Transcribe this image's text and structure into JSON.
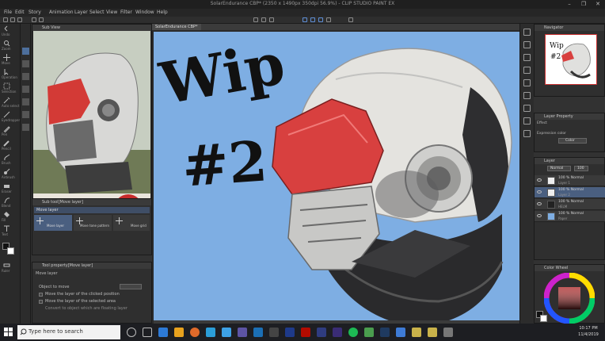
{
  "window": {
    "title": "SolarEndurance CBP* (2350 x 1490px 350dpi 56.9%)  -  CLIP STUDIO PAINT EX",
    "min": "–",
    "max": "❐",
    "close": "✕"
  },
  "menu": [
    "File",
    "Edit",
    "Story",
    "Animation",
    "Layer",
    "Select",
    "View",
    "Filter",
    "Window",
    "Help"
  ],
  "tools": [
    "Undo",
    "Redo",
    "Zoom",
    "Move",
    "Operation",
    "Move layer",
    "Selection",
    "Auto select",
    "Eyedropper",
    "Pen",
    "Pencil",
    "Brush",
    "Airbrush",
    "Decoration",
    "Eraser",
    "Blend",
    "Fill",
    "Gradient",
    "Figure",
    "Text",
    "Balloon",
    "Correct line",
    "Ruler"
  ],
  "reference_panel": {
    "title": "Sub View"
  },
  "subtool_panel": {
    "title": "Sub tool[Move layer]",
    "group": "Move layer",
    "options": [
      "Move layer",
      "Move tone pattern",
      "Move grid"
    ]
  },
  "tool_property": {
    "title": "Tool property[Move layer]",
    "header": "Move layer",
    "rows": [
      {
        "label": "Object to move"
      },
      {
        "label": "Move the layer of the clicked position"
      },
      {
        "label": "Move the layer of the selected area"
      },
      {
        "label": "Convert to object which are floating layer"
      }
    ]
  },
  "canvas": {
    "tab": "SolarEndurance CBP*",
    "wip_text": "Wip",
    "number_text": "#2",
    "background": "#7eaee3"
  },
  "navigator": {
    "title": "Navigator"
  },
  "layer_property": {
    "title": "Layer Property",
    "effect": "Effect",
    "expression": "Expression color",
    "color_value": "Color"
  },
  "layers": {
    "title": "Layer",
    "blend_mode": "Normal",
    "opacity": "100",
    "items": [
      {
        "name": "100 % Normal",
        "sub": "Layer 1"
      },
      {
        "name": "100 % Normal",
        "sub": "Layer 2"
      },
      {
        "name": "100 % Normal",
        "sub": "HELM"
      },
      {
        "name": "100 % Normal",
        "sub": "Paper"
      }
    ]
  },
  "color_panel": {
    "title": "Color Wheel"
  },
  "taskbar": {
    "search_placeholder": "Type here to search",
    "time": "10:17 PM",
    "date": "11/4/2019"
  }
}
